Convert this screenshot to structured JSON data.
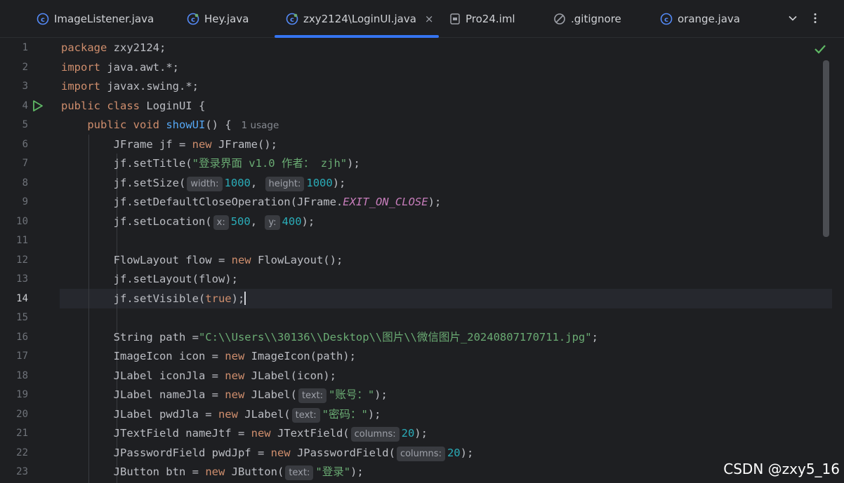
{
  "tabs": [
    {
      "label": "ImageListener.java",
      "icon": "java-class-icon"
    },
    {
      "label": "Hey.java",
      "icon": "java-class-icon"
    },
    {
      "label": "zxy2124\\LoginUI.java",
      "icon": "java-class-icon",
      "active": true
    },
    {
      "label": "Pro24.iml",
      "icon": "module-file-icon"
    },
    {
      "label": ".gitignore",
      "icon": "ignore-file-icon"
    },
    {
      "label": "orange.java",
      "icon": "java-class-icon"
    }
  ],
  "tab_close_label": "×",
  "tabbar_actions": [
    "chevron-down-icon",
    "more-vertical-icon"
  ],
  "current_line": 14,
  "inlay_hints": {
    "usage": "1 usage",
    "width": "width:",
    "height": "height:",
    "x": "x:",
    "y": "y:",
    "text": "text:",
    "columns": "columns:"
  },
  "code_lines": [
    {
      "n": "1",
      "text": "package zxy2124;"
    },
    {
      "n": "2",
      "text": "import java.awt.*;"
    },
    {
      "n": "3",
      "text": "import javax.swing.*;"
    },
    {
      "n": "4",
      "text": "public class LoginUI {"
    },
    {
      "n": "5",
      "text": "    public void showUI() {"
    },
    {
      "n": "6",
      "text": "        JFrame jf = new JFrame();"
    },
    {
      "n": "7",
      "text": "        jf.setTitle(\"登录界面 v1.0 作者： zjh\");"
    },
    {
      "n": "8",
      "text": "        jf.setSize(1000, 1000);"
    },
    {
      "n": "9",
      "text": "        jf.setDefaultCloseOperation(JFrame.EXIT_ON_CLOSE);"
    },
    {
      "n": "10",
      "text": "        jf.setLocation(500, 400);"
    },
    {
      "n": "11",
      "text": ""
    },
    {
      "n": "12",
      "text": "        FlowLayout flow = new FlowLayout();"
    },
    {
      "n": "13",
      "text": "        jf.setLayout(flow);"
    },
    {
      "n": "14",
      "text": "        jf.setVisible(true);"
    },
    {
      "n": "15",
      "text": ""
    },
    {
      "n": "16",
      "text": "        String path =\"C:\\\\Users\\\\30136\\\\Desktop\\\\图片\\\\微信图片_20240807170711.jpg\";"
    },
    {
      "n": "17",
      "text": "        ImageIcon icon = new ImageIcon(path);"
    },
    {
      "n": "18",
      "text": "        JLabel iconJla = new JLabel(icon);"
    },
    {
      "n": "19",
      "text": "        JLabel nameJla = new JLabel(\"账号：\");"
    },
    {
      "n": "20",
      "text": "        JLabel pwdJla = new JLabel(\"密码：\");"
    },
    {
      "n": "21",
      "text": "        JTextField nameJtf = new JTextField(20);"
    },
    {
      "n": "22",
      "text": "        JPasswordField pwdJpf = new JPasswordField(20);"
    },
    {
      "n": "23",
      "text": "        JButton btn = new JButton(\"登录\");"
    }
  ],
  "watermark": "CSDN @zxy5_16",
  "colors": {
    "background": "#1e1f22",
    "keyword": "#cf8e6d",
    "method": "#56a8f5",
    "string": "#6aab73",
    "number": "#2aacb8",
    "constant": "#c77dbb",
    "accent": "#3574f0"
  }
}
